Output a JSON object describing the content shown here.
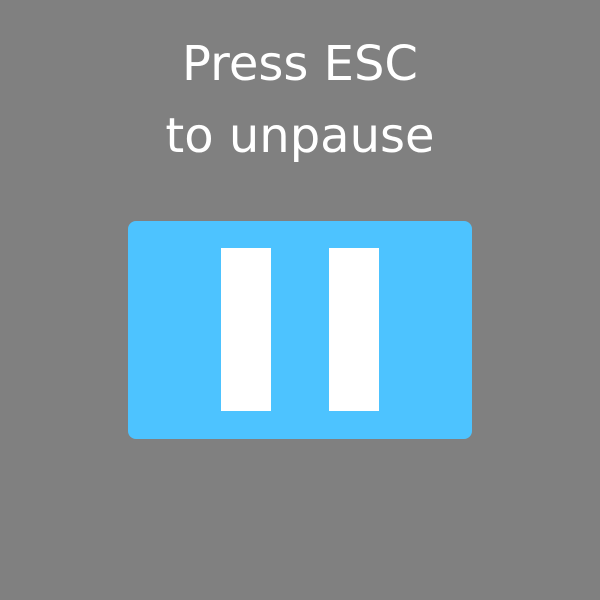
{
  "pause_overlay": {
    "message_line1": "Press ESC",
    "message_line2": "to unpause",
    "button_icon": "pause-icon",
    "background_color": "#808080",
    "button_color": "#4dc3ff",
    "text_color": "#ffffff"
  }
}
